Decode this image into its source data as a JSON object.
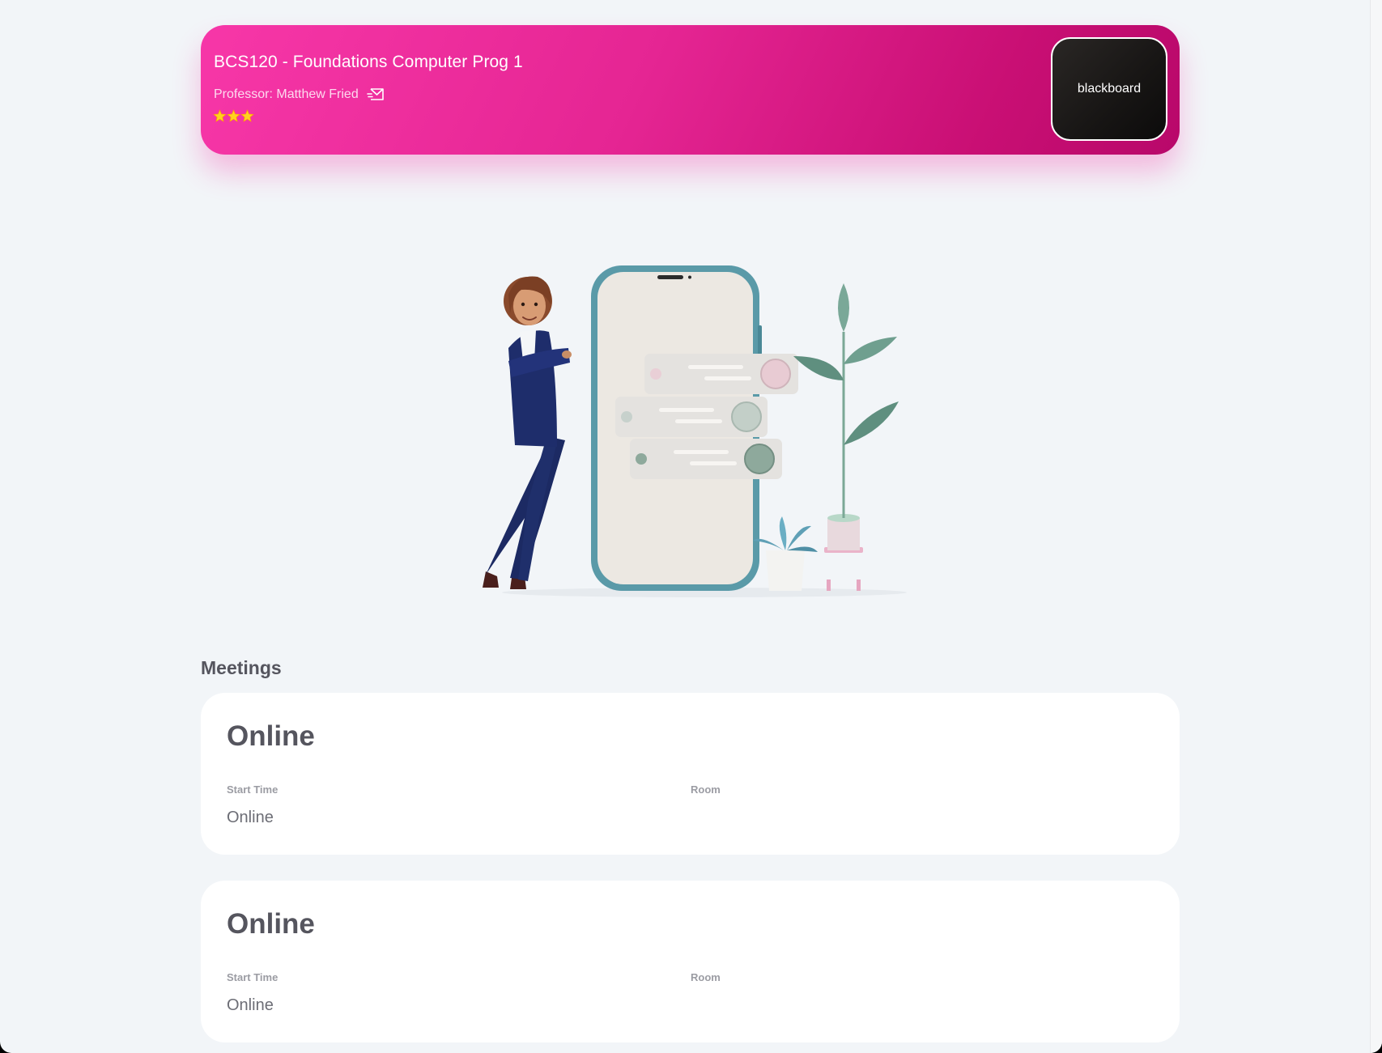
{
  "course": {
    "title": "BCS120 - Foundations Computer Prog 1",
    "professor": "Professor: Matthew Fried",
    "rating_stars": 3,
    "blackboard_label": "blackboard",
    "gradient_colors": [
      "#f737a8",
      "#b8086a"
    ]
  },
  "meetings": {
    "section_title": "Meetings",
    "items": [
      {
        "type": "Online",
        "start_time_label": "Start Time",
        "start_time_value": "Online",
        "room_label": "Room",
        "room_value": ""
      },
      {
        "type": "Online",
        "start_time_label": "Start Time",
        "start_time_value": "Online",
        "room_label": "Room",
        "room_value": ""
      }
    ]
  }
}
